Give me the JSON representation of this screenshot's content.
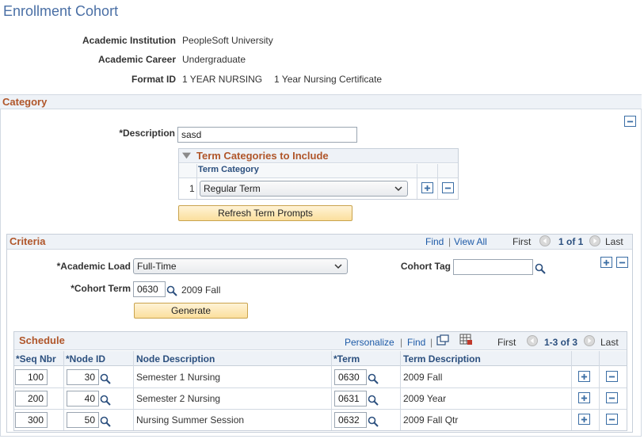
{
  "page": {
    "title": "Enrollment Cohort"
  },
  "header": {
    "institution_label": "Academic Institution",
    "institution_value": "PeopleSoft University",
    "career_label": "Academic Career",
    "career_value": "Undergraduate",
    "format_label": "Format ID",
    "format_id": "1 YEAR NURSING",
    "format_desc": "1 Year Nursing Certificate"
  },
  "category": {
    "title": "Category",
    "description_label": "*Description",
    "description_value": "sasd",
    "term_categories": {
      "title": "Term Categories to Include",
      "column_header": "Term Category",
      "rows": [
        {
          "num": "1",
          "value": "Regular Term"
        }
      ]
    },
    "refresh_button": "Refresh Term Prompts"
  },
  "criteria": {
    "title": "Criteria",
    "nav": {
      "find": "Find",
      "separator": "|",
      "view_all": "View All",
      "first": "First",
      "counter": "1 of 1",
      "last": "Last"
    },
    "academic_load_label": "*Academic Load",
    "academic_load_value": "Full-Time",
    "cohort_tag_label": "Cohort Tag",
    "cohort_tag_value": "",
    "cohort_term_label": "*Cohort Term",
    "cohort_term_value": "0630",
    "cohort_term_desc": "2009 Fall",
    "generate_button": "Generate"
  },
  "schedule": {
    "title": "Schedule",
    "nav": {
      "personalize": "Personalize",
      "separator": "|",
      "find": "Find",
      "sep2": "|",
      "first": "First",
      "counter": "1-3 of 3",
      "last": "Last"
    },
    "columns": [
      "*Seq Nbr",
      "*Node ID",
      "Node Description",
      "*Term",
      "Term Description"
    ],
    "rows": [
      {
        "seq": "100",
        "node": "30",
        "node_desc": "Semester 1 Nursing",
        "term": "0630",
        "term_desc": "2009 Fall"
      },
      {
        "seq": "200",
        "node": "40",
        "node_desc": "Semester 2 Nursing",
        "term": "0631",
        "term_desc": "2009 Year"
      },
      {
        "seq": "300",
        "node": "50",
        "node_desc": "Nursing Summer Session",
        "term": "0632",
        "term_desc": "2009 Fall Qtr"
      }
    ]
  },
  "colors": {
    "accent": "#b0562a",
    "link": "#1d5aa7",
    "title": "#4a6fa5",
    "button": "#fbdf9d"
  }
}
